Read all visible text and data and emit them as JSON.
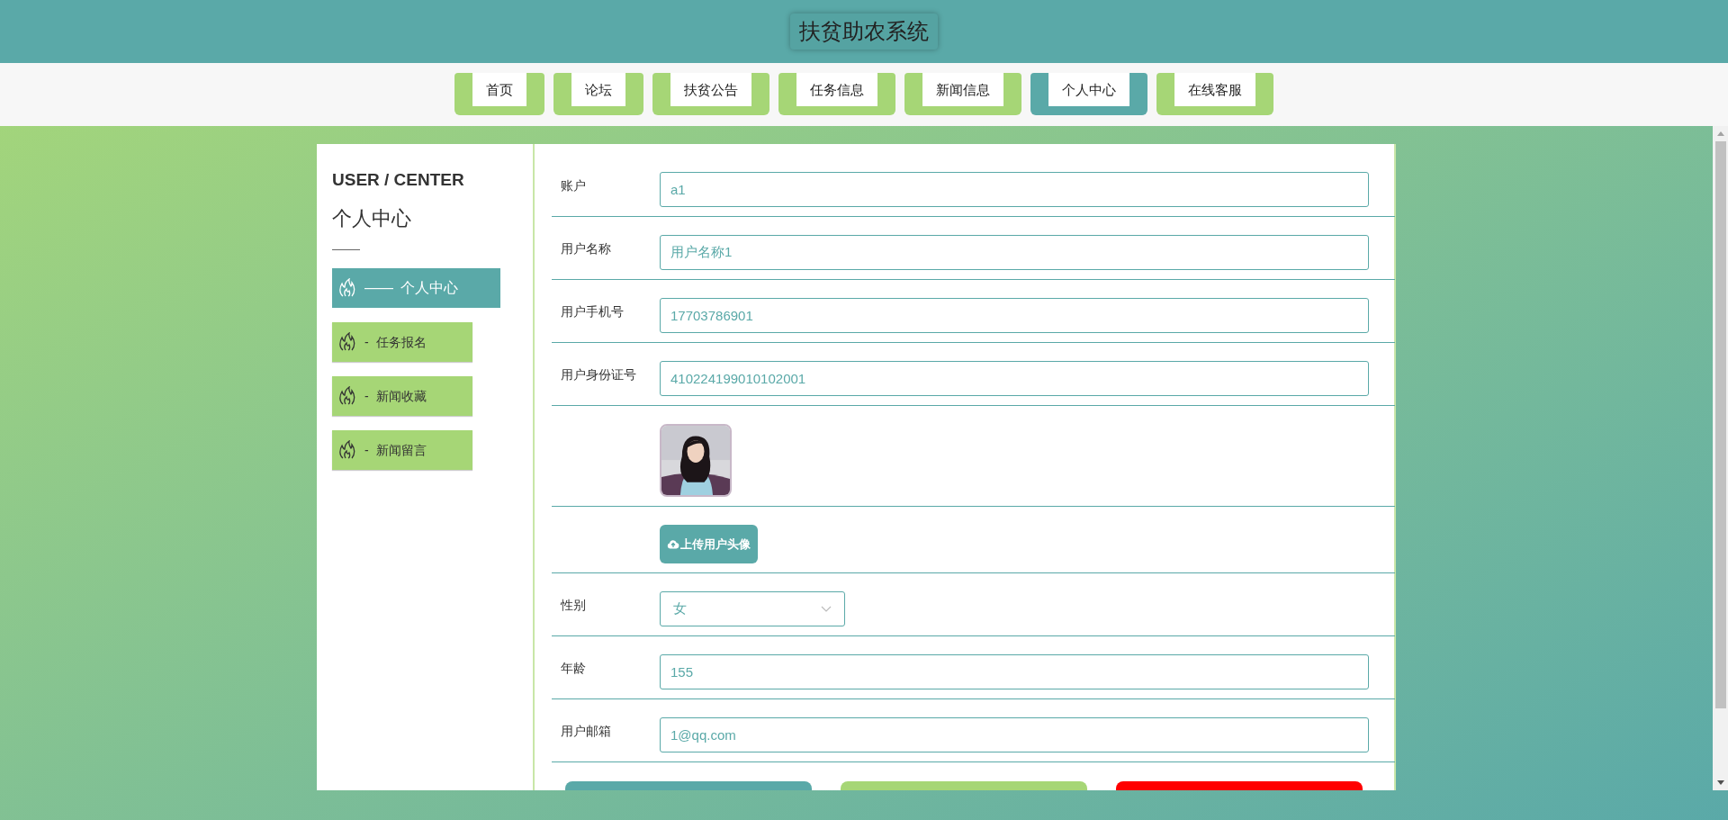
{
  "header": {
    "title": "扶贫助农系统"
  },
  "nav": [
    {
      "label": "首页",
      "selected": false
    },
    {
      "label": "论坛",
      "selected": false
    },
    {
      "label": "扶贫公告",
      "selected": false
    },
    {
      "label": "任务信息",
      "selected": false
    },
    {
      "label": "新闻信息",
      "selected": false
    },
    {
      "label": "个人中心",
      "selected": true
    },
    {
      "label": "在线客服",
      "selected": false
    }
  ],
  "sidebar": {
    "title_en": "USER / CENTER",
    "title": "个人中心",
    "items": [
      {
        "dash": "——",
        "label": "个人中心",
        "selected": true
      },
      {
        "dash": "-",
        "label": "任务报名",
        "selected": false
      },
      {
        "dash": "-",
        "label": "新闻收藏",
        "selected": false
      },
      {
        "dash": "-",
        "label": "新闻留言",
        "selected": false
      }
    ]
  },
  "form": {
    "fields": [
      {
        "kind": "input",
        "label": "账户",
        "value": "a1"
      },
      {
        "kind": "input",
        "label": "用户名称",
        "value": "用户名称1"
      },
      {
        "kind": "input",
        "label": "用户手机号",
        "value": "17703786901"
      },
      {
        "kind": "input",
        "label": "用户身份证号",
        "value": "410224199010102001"
      },
      {
        "kind": "avatar"
      },
      {
        "kind": "upload",
        "button": "上传用户头像"
      },
      {
        "kind": "select",
        "label": "性别",
        "value": "女"
      },
      {
        "kind": "input",
        "label": "年龄",
        "value": "155"
      },
      {
        "kind": "input",
        "label": "用户邮箱",
        "value": "1@qq.com"
      }
    ],
    "action_buttons": [
      {
        "color": "#5aa9a8"
      },
      {
        "color": "#a6d676"
      },
      {
        "color": "#ff0000"
      }
    ]
  }
}
